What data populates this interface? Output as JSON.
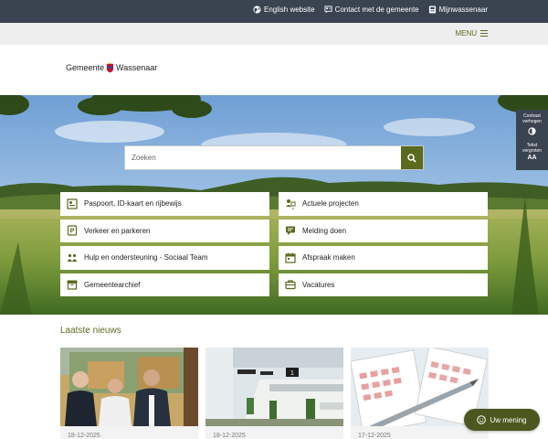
{
  "top_links": [
    {
      "label": "English website",
      "icon": "globe-icon"
    },
    {
      "label": "Contact met de gemeente",
      "icon": "contact-icon"
    },
    {
      "label": "Mijnwassenaar",
      "icon": "account-icon"
    }
  ],
  "menu": {
    "label": "MENU"
  },
  "logo": {
    "part1": "Gemeente",
    "part2": "Wassenaar"
  },
  "search": {
    "placeholder": "Zoeken"
  },
  "tiles": [
    {
      "label": "Paspoort, ID-kaart en rijbewijs",
      "icon": "id-card-icon"
    },
    {
      "label": "Actuele projecten",
      "icon": "projects-icon"
    },
    {
      "label": "Verkeer en parkeren",
      "icon": "parking-icon"
    },
    {
      "label": "Melding doen",
      "icon": "report-icon"
    },
    {
      "label": "Hulp en ondersteuning - Sociaal Team",
      "icon": "people-icon"
    },
    {
      "label": "Afspraak maken",
      "icon": "appointment-icon"
    },
    {
      "label": "Gemeentearchief",
      "icon": "archive-icon"
    },
    {
      "label": "Vacatures",
      "icon": "briefcase-icon"
    }
  ],
  "accessibility": {
    "contrast_label_1": "Contrast",
    "contrast_label_2": "verhogen",
    "text_label_1": "Tekst",
    "text_label_2": "vergroten",
    "text_glyph": "AA"
  },
  "news": {
    "title": "Laatste nieuws",
    "items": [
      {
        "date": "18-12-2025",
        "image": "three-men-photo"
      },
      {
        "date": "18-12-2025",
        "image": "office-interior-photo"
      },
      {
        "date": "17-12-2025",
        "image": "calendar-pen-photo"
      }
    ]
  },
  "feedback": {
    "label": "Uw mening",
    "icon": "smiley-icon"
  },
  "colors": {
    "accent": "#5a6b1f",
    "topbar": "#3a4350",
    "menubar": "#eeeeee"
  }
}
